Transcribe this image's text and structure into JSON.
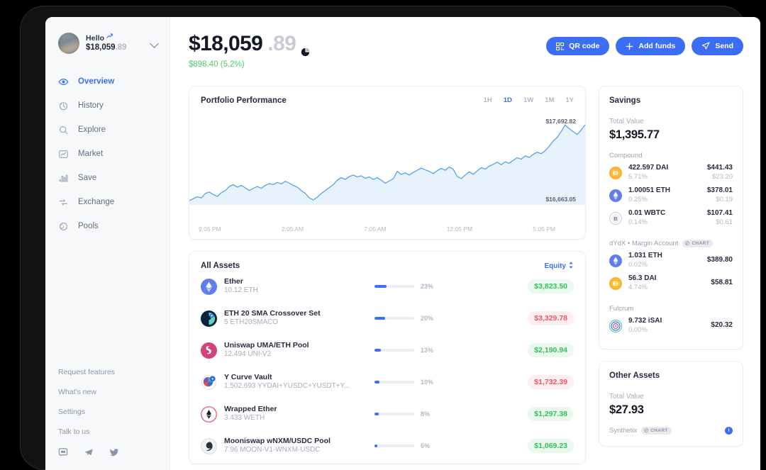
{
  "sidebar": {
    "profile": {
      "greeting": "Hello",
      "spark_icon": "sparkle-icon",
      "balance_main": "$18,059",
      "balance_cents": ".89",
      "chevron_icon": "chevron-down-icon",
      "avatar_name": "avatar"
    },
    "nav": [
      {
        "label": "Overview",
        "icon": "eye-icon",
        "active": true
      },
      {
        "label": "History",
        "icon": "clock-history-icon",
        "active": false
      },
      {
        "label": "Explore",
        "icon": "search-icon",
        "active": false
      },
      {
        "label": "Market",
        "icon": "chart-line-icon",
        "active": false
      },
      {
        "label": "Save",
        "icon": "bar-chart-icon",
        "active": false
      },
      {
        "label": "Exchange",
        "icon": "exchange-arrows-icon",
        "active": false
      },
      {
        "label": "Pools",
        "icon": "pools-icon",
        "active": false
      }
    ],
    "links": [
      "Request features",
      "What's new",
      "Settings",
      "Talk to us"
    ],
    "socials": [
      "chat-icon",
      "telegram-icon",
      "twitter-icon"
    ]
  },
  "header": {
    "balance_main": "$18,059",
    "balance_cents": ".89",
    "pie_icon": "pie-chart-icon",
    "change": "$898.40 (5.2%)",
    "change_color": "#4fc76a",
    "buttons": [
      {
        "label": "QR code",
        "icon": "qr-code-icon"
      },
      {
        "label": "Add funds",
        "icon": "plus-icon"
      },
      {
        "label": "Send",
        "icon": "send-icon"
      }
    ],
    "button_color": "#3b6ef5"
  },
  "chart_card": {
    "title": "Portfolio Performance",
    "ranges": [
      "1H",
      "1D",
      "1W",
      "1M",
      "1Y"
    ],
    "selected_range": "1D"
  },
  "chart_data": {
    "type": "line",
    "title": "Portfolio Performance",
    "xlabel": "",
    "ylabel": "",
    "high_label": "$17,692.82",
    "low_label": "$16,663.05",
    "ylim": [
      16663.05,
      17692.82
    ],
    "grid": false,
    "legend": "none",
    "line_color": "#4a9cf0",
    "fill_color": "#e8f2fd",
    "tick_labels": [
      "9:05 PM",
      "2:05 AM",
      "7:05 AM",
      "12:05 PM",
      "5:05 PM"
    ],
    "x": [
      0,
      1,
      2,
      3,
      4,
      5,
      6,
      7,
      8,
      9,
      10,
      11,
      12,
      13,
      14,
      15,
      16,
      17,
      18,
      19,
      20,
      21,
      22,
      23,
      24,
      25,
      26,
      27,
      28,
      29,
      30,
      31,
      32,
      33,
      34,
      35,
      36,
      37,
      38,
      39,
      40,
      41,
      42,
      43,
      44,
      45,
      46,
      47,
      48,
      49,
      50,
      51,
      52,
      53,
      54,
      55,
      56,
      57,
      58,
      59,
      60,
      61,
      62,
      63,
      64,
      65,
      66,
      67,
      68,
      69,
      70,
      71,
      72,
      73,
      74,
      75,
      76,
      77,
      78,
      79,
      80,
      81,
      82,
      83,
      84,
      85,
      86,
      87,
      88,
      89,
      90,
      91,
      92,
      93,
      94,
      95,
      96,
      97,
      98,
      99
    ],
    "values": [
      16663,
      16690,
      16715,
      16700,
      16760,
      16780,
      16745,
      16720,
      16770,
      16800,
      16855,
      16880,
      16845,
      16870,
      16835,
      16800,
      16830,
      16855,
      16830,
      16870,
      16895,
      16880,
      16910,
      16890,
      16925,
      16900,
      16870,
      16845,
      16800,
      16760,
      16700,
      16672,
      16710,
      16760,
      16800,
      16840,
      16880,
      16940,
      16975,
      16950,
      16990,
      17010,
      16985,
      17000,
      16965,
      16985,
      16950,
      16975,
      16940,
      16900,
      16930,
      16960,
      17060,
      17020,
      17040,
      17010,
      17045,
      17075,
      17105,
      17080,
      17060,
      17030,
      17070,
      17100,
      17075,
      17120,
      17090,
      16990,
      16960,
      17010,
      17055,
      17020,
      17065,
      17110,
      17090,
      17130,
      17155,
      17185,
      17150,
      17190,
      17170,
      17210,
      17245,
      17225,
      17270,
      17250,
      17290,
      17320,
      17300,
      17340,
      17400,
      17470,
      17520,
      17600,
      17690,
      17640,
      17600,
      17560,
      17620,
      17692
    ]
  },
  "assets_card": {
    "title": "All Assets",
    "sort_label": "Equity",
    "sort_icon": "sort-updown-icon",
    "rows": [
      {
        "name": "Ether",
        "qty": "10.12 ETH",
        "pct": "23%",
        "pct_value": 23,
        "value": "$3,823.50",
        "direction": "up",
        "icon": "ether-icon"
      },
      {
        "name": "ETH 20 SMA Crossover Set",
        "qty": "5 ETH20SMACO",
        "pct": "20%",
        "pct_value": 20,
        "value": "$3,329.78",
        "direction": "down",
        "icon": "set-protocol-icon"
      },
      {
        "name": "Uniswap UMA/ETH Pool",
        "qty": "12.494 UNI-V2",
        "pct": "13%",
        "pct_value": 13,
        "value": "$2,190.94",
        "direction": "up",
        "icon": "uniswap-icon"
      },
      {
        "name": "Y Curve Vault",
        "qty": "1,502.693 YYDAI+YUSDC+YUSDT+Y...",
        "pct": "10%",
        "pct_value": 10,
        "value": "$1,732.39",
        "direction": "down",
        "icon": "ycurve-icon"
      },
      {
        "name": "Wrapped Ether",
        "qty": "3.433 WETH",
        "pct": "8%",
        "pct_value": 8,
        "value": "$1,297.38",
        "direction": "up",
        "icon": "wrapped-ether-icon"
      },
      {
        "name": "Mooniswap wNXM/USDC Pool",
        "qty": "7.96 MOON-V1-WNXM-USDC",
        "pct": "6%",
        "pct_value": 6,
        "value": "$1,069.23",
        "direction": "up",
        "icon": "mooniswap-icon"
      }
    ]
  },
  "savings_card": {
    "title": "Savings",
    "total_label": "Total Value",
    "total_value": "$1,395.77",
    "groups": [
      {
        "label": "Compound",
        "chip": null,
        "holdings": [
          {
            "name": "422.597 DAI",
            "apy": "5.71%",
            "value": "$441.43",
            "earned": "$23.20",
            "icon": "dai-icon"
          },
          {
            "name": "1.00051 ETH",
            "apy": "0.25%",
            "value": "$378.01",
            "earned": "$0.19",
            "icon": "ether-icon"
          },
          {
            "name": "0.01 WBTC",
            "apy": "0.14%",
            "value": "$107.41",
            "earned": "$0.61",
            "icon": "wbtc-icon"
          }
        ]
      },
      {
        "label": "dYdX • Margin Account",
        "chip": "CHART",
        "holdings": [
          {
            "name": "1.031 ETH",
            "apy": "0.02%",
            "value": "$389.80",
            "earned": "",
            "icon": "ether-icon"
          },
          {
            "name": "56.3 DAI",
            "apy": "4.74%",
            "value": "$58.81",
            "earned": "",
            "icon": "dai-icon"
          }
        ]
      },
      {
        "label": "Fulcrum",
        "chip": null,
        "holdings": [
          {
            "name": "9.732 iSAI",
            "apy": "0.00%",
            "value": "$20.32",
            "earned": "",
            "icon": "fulcrum-icon"
          }
        ]
      }
    ]
  },
  "other_assets_card": {
    "title": "Other Assets",
    "total_label": "Total Value",
    "total_value": "$27.93",
    "group_label": "Synthetix",
    "chip": "CHART",
    "info_icon": "info-icon",
    "info_label": "i"
  }
}
